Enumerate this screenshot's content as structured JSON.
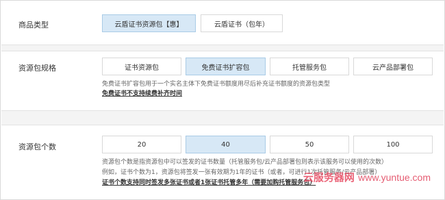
{
  "product_type": {
    "label": "商品类型",
    "options": [
      {
        "label": "云盾证书资源包【惠】",
        "selected": true
      },
      {
        "label": "云盾证书（包年）",
        "selected": false
      }
    ]
  },
  "pack_spec": {
    "label": "资源包规格",
    "options": [
      {
        "label": "证书资源包",
        "selected": false
      },
      {
        "label": "免费证书扩容包",
        "selected": true
      },
      {
        "label": "托管服务包",
        "selected": false
      },
      {
        "label": "云产品部署包",
        "selected": false
      }
    ],
    "desc_line1": "免费证书扩容包用于一个实名主体下免费证书额度用尽后补充证书额度的资源包类型",
    "desc_line2": "免费证书不支持续费补齐时间"
  },
  "pack_count": {
    "label": "资源包个数",
    "options": [
      {
        "label": "20",
        "selected": false
      },
      {
        "label": "40",
        "selected": true
      },
      {
        "label": "50",
        "selected": false
      },
      {
        "label": "100",
        "selected": false
      }
    ],
    "desc_line1": "资源包个数是指资源包中可以签发的证书数量（托管服务包/云产品部署包则表示该服务可以使用的次数）",
    "desc_line2": "例如，证书个数为1，资源包将签发一张有效期为1年的证书（或者，可进行1次托管服务/云产品部署）",
    "desc_line3": "证书个数支持同时签发多张证书或者1张证书托管多年（需要加购托管服务包）"
  },
  "watermark": {
    "text_cn": "云服务器网",
    "text_en": "www.yuntue.com",
    "color": "#e8546a"
  },
  "colors": {
    "selected_bg": "#d7e8f6",
    "selected_border": "#a9cbe6",
    "gap_bg": "#f4f4f4"
  }
}
